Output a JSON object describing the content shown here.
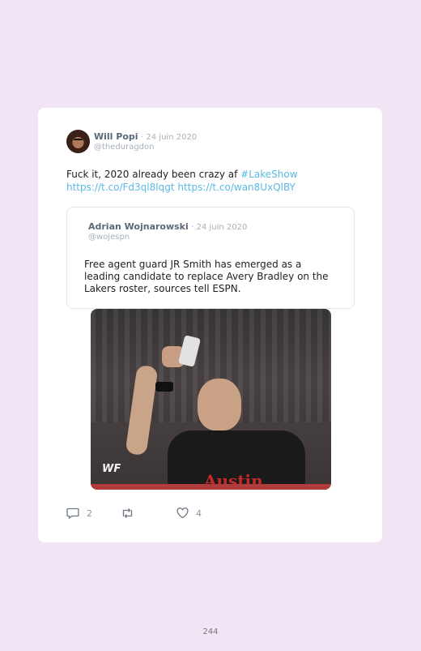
{
  "tweet": {
    "author_name": "Will Popi",
    "date": "· 24 juin 2020",
    "handle": "@theduragdon",
    "text_line1": "Fuck it, 2020 already been crazy af ",
    "hashtag": "#LakeShow",
    "link1": "https://t.co/Fd3ql8lqgt",
    "link2": "https://t.co/wan8UxQlBY"
  },
  "quoted": {
    "author_name": "Adrian Wojnarowski",
    "date": "· 24 juin 2020",
    "handle": "@wojespn",
    "text": "Free agent guard JR Smith has emerged as a leading candidate to replace Avery Bradley on the Lakers roster, sources tell ESPN."
  },
  "media": {
    "shirt_text": "Austin",
    "logo_text": "WF"
  },
  "actions": {
    "reply_count": "2",
    "like_count": "4"
  },
  "page": {
    "number": "244"
  }
}
